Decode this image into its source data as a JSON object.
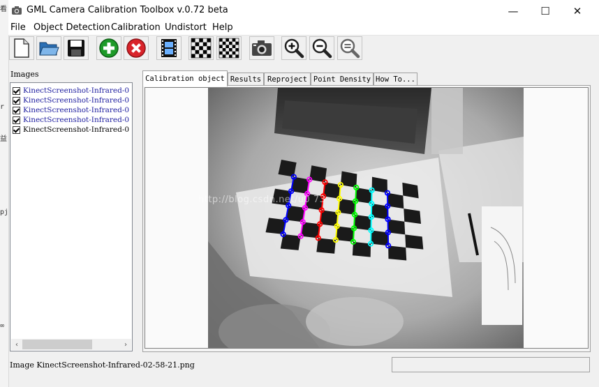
{
  "window": {
    "title": "GML Camera Calibration Toolbox  v.0.72 beta",
    "controls": {
      "minimize": "—",
      "maximize": "☐",
      "close": "✕"
    }
  },
  "menu": [
    "File",
    "Object Detection",
    "Calibration",
    "Undistort",
    "Help"
  ],
  "toolbar": {
    "icons": [
      "new-file-icon",
      "open-folder-icon",
      "save-disk-icon",
      "add-icon",
      "remove-icon",
      "film-icon",
      "checkerboard-icon",
      "checkerboard-alt-icon",
      "camera-icon",
      "zoom-in-icon",
      "zoom-out-icon",
      "zoom-reset-icon"
    ]
  },
  "images_panel": {
    "label": "Images",
    "items": [
      {
        "name": "KinectScreenshot-Infrared-0",
        "checked": true
      },
      {
        "name": "KinectScreenshot-Infrared-0",
        "checked": true
      },
      {
        "name": "KinectScreenshot-Infrared-0",
        "checked": true
      },
      {
        "name": "KinectScreenshot-Infrared-0",
        "checked": true
      },
      {
        "name": "KinectScreenshot-Infrared-0",
        "checked": true
      }
    ],
    "scroll_left": "‹",
    "scroll_right": "›"
  },
  "tabs": [
    "Calibration object",
    "Results",
    "Reproject",
    "Point Density",
    "How To..."
  ],
  "active_tab": "Calibration object",
  "watermark": "http://blog.csdn.net/u0       73",
  "status": {
    "text": "Image KinectScreenshot-Infrared-02-58-21.png"
  },
  "left_strip_glyphs": [
    "看",
    "r",
    "益",
    "pj",
    "∞"
  ],
  "colors": {
    "row_lines": [
      "#0000ff",
      "#ff00ff",
      "#ff0000",
      "#ffff00",
      "#00ff00",
      "#00ffff",
      "#0000ff"
    ],
    "list_text": "#2020a0"
  }
}
